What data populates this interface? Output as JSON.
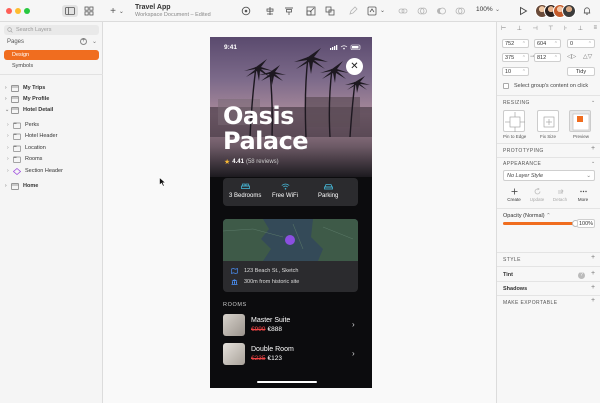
{
  "window": {
    "title": "Travel App",
    "subtitle": "Workspace Document – Edited"
  },
  "toolbar": {
    "add_label": "+",
    "zoom": "100%",
    "zoom_arrow": "⌄",
    "icons": [
      "insert-icon",
      "edit-icon",
      "transform-icon",
      "rotate-icon",
      "mask-icon",
      "scale-icon",
      "flatten-icon",
      "pen-icon",
      "link-icon",
      "union-icon",
      "subtract-icon",
      "intersect-icon",
      "difference-icon",
      "export-icon"
    ],
    "colors": {
      "accent": "#f06d1f",
      "bg": "#f6f6f6"
    }
  },
  "sidebar": {
    "search_placeholder": "Search Layers",
    "pages_header": "Pages",
    "pages": [
      {
        "label": "Design",
        "active": true
      },
      {
        "label": "Symbols",
        "active": false
      }
    ],
    "layers": [
      {
        "label": "My Trips",
        "level": 0,
        "bold": true,
        "expanded": false,
        "icon": "artboard-icon"
      },
      {
        "label": "My Profile",
        "level": 0,
        "bold": true,
        "expanded": false,
        "icon": "artboard-icon"
      },
      {
        "label": "Hotel Detail",
        "level": 0,
        "bold": true,
        "expanded": true,
        "icon": "artboard-icon"
      },
      {
        "label": "Perks",
        "level": 1,
        "bold": false,
        "expanded": false,
        "icon": "group-icon"
      },
      {
        "label": "Hotel Header",
        "level": 1,
        "bold": false,
        "expanded": false,
        "icon": "group-icon"
      },
      {
        "label": "Location",
        "level": 1,
        "bold": false,
        "expanded": false,
        "icon": "group-icon"
      },
      {
        "label": "Rooms",
        "level": 1,
        "bold": false,
        "expanded": false,
        "icon": "group-icon"
      },
      {
        "label": "Section Header",
        "level": 1,
        "bold": false,
        "expanded": false,
        "icon": "symbol-icon"
      },
      {
        "label": "Home",
        "level": 0,
        "bold": true,
        "expanded": false,
        "icon": "artboard-icon"
      }
    ]
  },
  "artboard": {
    "status_time": "9:41",
    "hotel_name_line1": "Oasis",
    "hotel_name_line2": "Palace",
    "rating_score": "4.41",
    "rating_reviews": "(58 reviews)",
    "amenities": [
      {
        "label": "3 Bedrooms",
        "icon": "bed-icon"
      },
      {
        "label": "Free WiFi",
        "icon": "wifi-icon"
      },
      {
        "label": "Parking",
        "icon": "car-icon"
      }
    ],
    "location": {
      "address": "123 Beach St., Sketch",
      "distance": "300m from historic site"
    },
    "rooms_header": "ROOMS",
    "rooms": [
      {
        "name": "Master Suite",
        "old_price": "€999",
        "price": "€888"
      },
      {
        "name": "Double Room",
        "old_price": "€235",
        "price": "€123"
      }
    ],
    "colors": {
      "price_strike": "#ef4444",
      "card": "#2b2b2e",
      "pin": "#8b4fe0",
      "amenity_icon": "#46b8d8"
    }
  },
  "inspector": {
    "x": "752",
    "y": "604",
    "rotation": "0",
    "width": "375",
    "height": "812",
    "corner": "10",
    "tidy_label": "Tidy",
    "select_content_label": "Select group's content on click",
    "resizing_header": "RESIZING",
    "resizing_options": [
      "Pin to Edge",
      "Fix Size",
      "Preview"
    ],
    "prototyping_header": "PROTOTYPING",
    "appearance_header": "APPEARANCE",
    "layer_style": "No Layer Style",
    "layer_style_actions": [
      {
        "label": "Create",
        "enabled": true
      },
      {
        "label": "Update",
        "enabled": false
      },
      {
        "label": "Detach",
        "enabled": false
      },
      {
        "label": "More",
        "enabled": true
      }
    ],
    "opacity_label": "Opacity (Normal)",
    "opacity_value": "100%",
    "opacity": 100,
    "style_header": "STYLE",
    "tint_label": "Tint",
    "shadows_label": "Shadows",
    "exportable_header": "MAKE EXPORTABLE"
  }
}
